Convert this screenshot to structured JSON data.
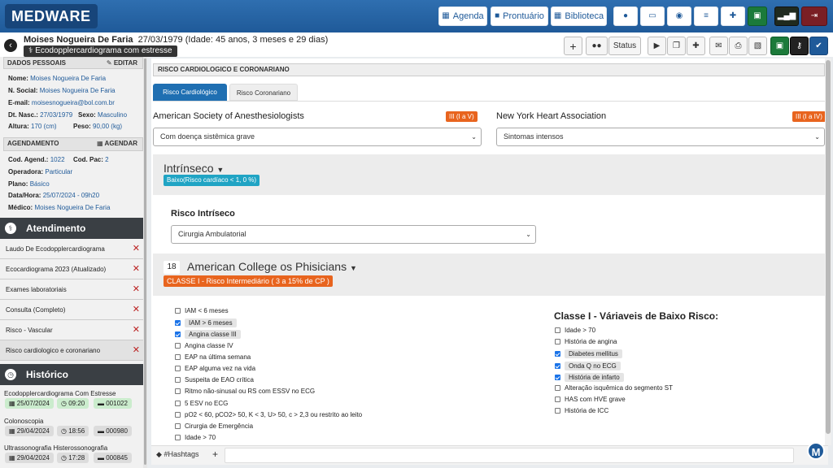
{
  "app": {
    "logo": "MEDWARE"
  },
  "topnav": {
    "agenda": "Agenda",
    "prontuario": "Prontuário",
    "biblioteca": "Biblioteca"
  },
  "patient": {
    "name": "Moises Nogueira De Faria",
    "info": "27/03/1979 (Idade: 45 anos, 3 meses e 29 dias)",
    "tag": "Ecodopplercardiograma com estresse"
  },
  "header_btns": {
    "status": "Status"
  },
  "dados": {
    "title": "DADOS PESSOAIS",
    "edit": "EDITAR",
    "nome_k": "Nome:",
    "nome_v": "Moises Nogueira De Faria",
    "nsocial_k": "N. Social:",
    "nsocial_v": "Moises Nogueira De Faria",
    "email_k": "E-mail:",
    "email_v": "moisesnogueira@bol.com.br",
    "dtnasc_k": "Dt. Nasc.:",
    "dtnasc_v": "27/03/1979",
    "sexo_k": "Sexo:",
    "sexo_v": "Masculino",
    "altura_k": "Altura:",
    "altura_v": "170 (cm)",
    "peso_k": "Peso:",
    "peso_v": "90,00 (kg)"
  },
  "agendamento": {
    "title": "AGENDAMENTO",
    "btn": "AGENDAR",
    "cod_k": "Cod. Agend.:",
    "cod_v": "1022",
    "codpac_k": "Cod. Pac:",
    "codpac_v": "2",
    "oper_k": "Operadora:",
    "oper_v": "Particular",
    "plano_k": "Plano:",
    "plano_v": "Básico",
    "data_k": "Data/Hora:",
    "data_v": "25/07/2024 - 09h20",
    "medico_k": "Médico:",
    "medico_v": "Moises Nogueira De Faria"
  },
  "atendimento": {
    "title": "Atendimento",
    "items": [
      "Laudo De Ecodopplercardiograma",
      "Ecocardiograma 2023 (Atualizado)",
      "Exames laboratoriais",
      "Consulta (Completo)",
      "Risco - Vascular",
      "Risco cardiologico e coronariano"
    ]
  },
  "historico": {
    "title": "Histórico",
    "items": [
      {
        "title": "Ecodopplercardiograma Com Estresse",
        "date": "25/07/2024",
        "time": "09:20",
        "code": "001022"
      },
      {
        "title": "Colonoscopia",
        "date": "29/04/2024",
        "time": "18:56",
        "code": "000980"
      },
      {
        "title": "Ultrassonografia Histerossonografia",
        "date": "29/04/2024",
        "time": "17:28",
        "code": "000845"
      }
    ]
  },
  "section": {
    "title": "RISCO CARDIOLOGICO E CORONARIANO",
    "tabs": [
      "Risco Cardiológico",
      "Risco Coronariano"
    ]
  },
  "asa": {
    "label": "American Society of Anesthesiologists",
    "badge": "III (I a V)",
    "value": "Com doença sistêmica grave"
  },
  "nyha": {
    "label": "New York Heart Association",
    "badge": "III (I a IV)",
    "value": "Sintomas intensos"
  },
  "intrinseco": {
    "title": "Intrínseco",
    "badge": "Baixo(Risco cardíaco < 1, 0 %)",
    "field_label": "Risco Intríseco",
    "value": "Cirurgia Ambulatorial"
  },
  "acp": {
    "score": "18",
    "title": "American College os Phisicians",
    "badge": "CLASSE I - Risco Intermediário ( 3 a 15% de CP )",
    "left": [
      {
        "t": "IAM < 6 meses",
        "c": false
      },
      {
        "t": "IAM > 6 meses",
        "c": true
      },
      {
        "t": "Angina classe III",
        "c": true
      },
      {
        "t": "Angina classe IV",
        "c": false
      },
      {
        "t": "EAP na última semana",
        "c": false
      },
      {
        "t": "EAP alguma vez na vida",
        "c": false
      },
      {
        "t": "Suspeita de EAO crítica",
        "c": false
      },
      {
        "t": "Ritmo não-sinusal ou RS com ESSV no ECG",
        "c": false
      },
      {
        "t": "5 ESV no ECG",
        "c": false
      },
      {
        "t": "pO2 < 60, pCO2> 50, K < 3, U> 50, c > 2,3 ou restrito ao leito",
        "c": false
      },
      {
        "t": "Cirurgia de Emergência",
        "c": false
      },
      {
        "t": "Idade > 70",
        "c": false
      }
    ],
    "right_title": "Classe I - Váriaveis de Baixo Risco:",
    "right": [
      {
        "t": "Idade > 70",
        "c": false
      },
      {
        "t": "História de angina",
        "c": false
      },
      {
        "t": "Diabetes mellitus",
        "c": true
      },
      {
        "t": "Onda Q no ECG",
        "c": true
      },
      {
        "t": "História de infarto",
        "c": true
      },
      {
        "t": "Alteração isquêmica do segmento ST",
        "c": false
      },
      {
        "t": "HAS com HVE grave",
        "c": false
      },
      {
        "t": "História de ICC",
        "c": false
      }
    ]
  },
  "footer": {
    "hashtags": "#Hashtags",
    "plus": "+",
    "avatar": "M"
  },
  "colors": {
    "brand": "#1f5a99",
    "orange": "#e8641e",
    "cyan": "#20a4c4",
    "green": "#1b7a3a"
  }
}
